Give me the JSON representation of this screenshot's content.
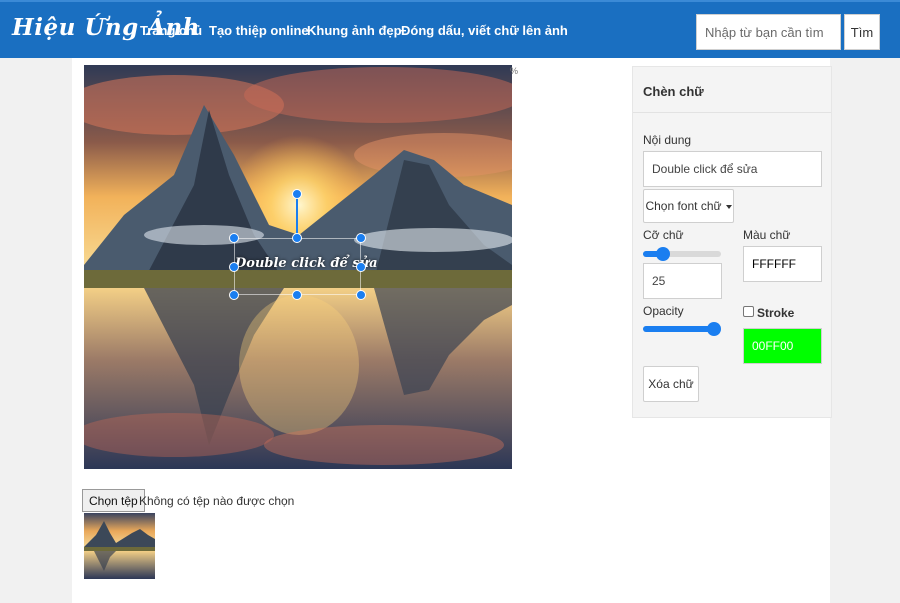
{
  "nav": {
    "brand": "Hiệu Ứng Ảnh",
    "links": [
      "Trang chủ",
      "Tạo thiệp online",
      "Khung ảnh đẹp",
      "Đóng dấu, viết chữ lên ảnh"
    ],
    "search_placeholder": "Nhập từ bạn cần tìm",
    "search_button": "Tìm"
  },
  "editor": {
    "overlay_text": "Double click để sửa",
    "corner_mark": "%"
  },
  "file": {
    "button": "Chọn tệp",
    "status": "Không có tệp nào được chọn"
  },
  "panel": {
    "title": "Chèn chữ",
    "content_label": "Nội dung",
    "content_value": "Double click để sửa",
    "font_button": "Chọn font chữ",
    "size_label": "Cỡ chữ",
    "size_value": "25",
    "size_slider_fraction": 0.2,
    "color_label": "Màu chữ",
    "color_value": "FFFFFF",
    "opacity_label": "Opacity",
    "opacity_slider_fraction": 1.0,
    "stroke_label": "Stroke",
    "stroke_checked": false,
    "stroke_color": "00FF00",
    "delete_button": "Xóa chữ"
  },
  "colors": {
    "navbar": "#1a6fc1",
    "accent": "#1a7ef0",
    "stroke_swatch": "#00ff00",
    "text_color_swatch": "#ffffff"
  }
}
